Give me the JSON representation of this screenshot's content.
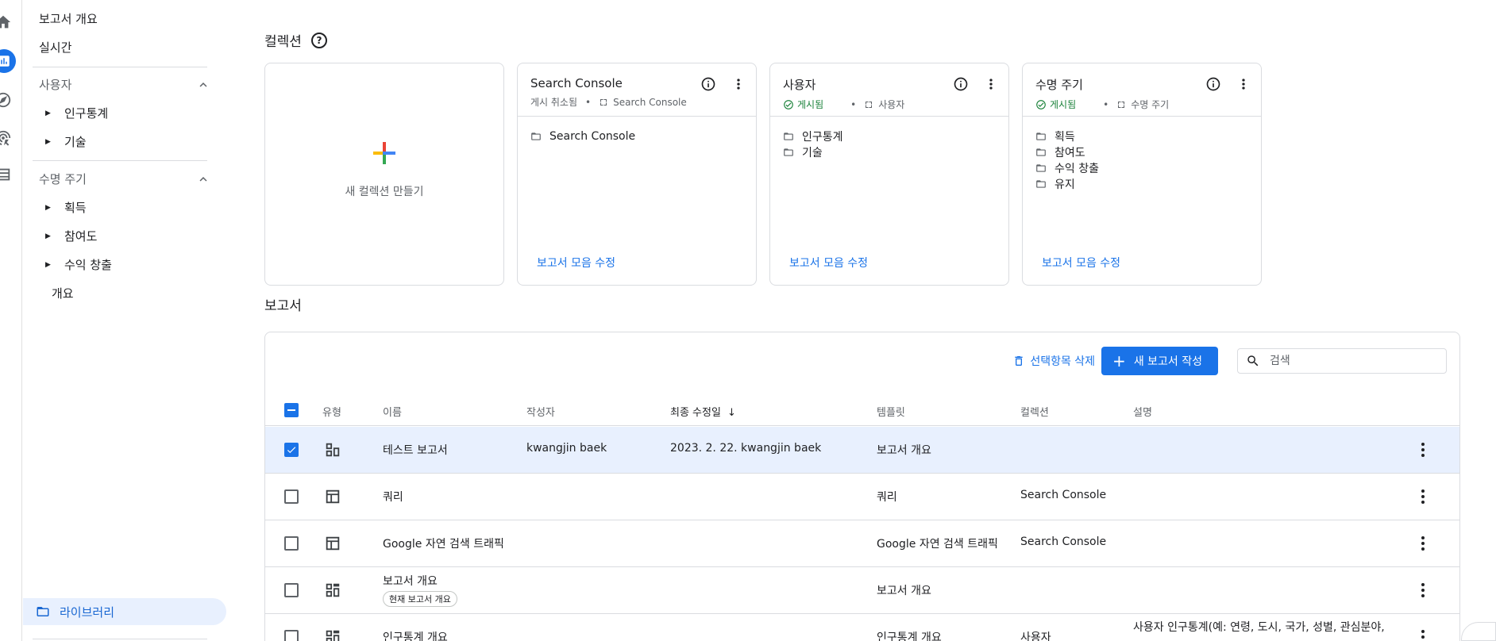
{
  "nav": {
    "overview": "보고서 개요",
    "realtime": "실시간",
    "section_user": "사용자",
    "demographics": "인구통계",
    "tech": "기술",
    "section_lifecycle": "수명 주기",
    "acquisition": "획득",
    "engagement": "참여도",
    "monetization": "수익 창출",
    "lifecycle_overview": "개요",
    "library": "라이브러리"
  },
  "collections": {
    "heading": "컬렉션",
    "new_label": "새 컬렉션 만들기",
    "edit_label": "보고서 모음 수정",
    "cards": [
      {
        "title": "Search Console",
        "status": "게시 취소됨",
        "template": "Search Console",
        "folders": [
          "Search Console"
        ]
      },
      {
        "title": "사용자",
        "status": "게시됨",
        "template": "사용자",
        "folders": [
          "인구통계",
          "기술"
        ]
      },
      {
        "title": "수명 주기",
        "status": "게시됨",
        "template": "수명 주기",
        "folders": [
          "획득",
          "참여도",
          "수익 창출",
          "유지"
        ]
      }
    ]
  },
  "reports": {
    "heading": "보고서",
    "delete_label": "선택항목 삭제",
    "new_label": "새 보고서 작성",
    "search_placeholder": "검색",
    "columns": {
      "type": "유형",
      "name": "이름",
      "author": "작성자",
      "modified": "최종 수정일",
      "template": "템플릿",
      "collection": "컬렉션",
      "description": "설명"
    },
    "rows": [
      {
        "name": "테스트 보고서",
        "author": "kwangjin baek",
        "modified": "2023. 2. 22. kwangjin baek",
        "template": "보고서 개요",
        "collection": "",
        "description": "",
        "chip": ""
      },
      {
        "name": "쿼리",
        "author": "",
        "modified": "",
        "template": "쿼리",
        "collection": "Search Console",
        "description": "",
        "chip": ""
      },
      {
        "name": "Google 자연 검색 트래픽",
        "author": "",
        "modified": "",
        "template": "Google 자연 검색 트래픽",
        "collection": "Search Console",
        "description": "",
        "chip": ""
      },
      {
        "name": "보고서 개요",
        "author": "",
        "modified": "",
        "template": "보고서 개요",
        "collection": "",
        "description": "",
        "chip": "현재 보고서 개요"
      },
      {
        "name": "인구통계 개요",
        "author": "",
        "modified": "",
        "template": "인구통계 개요",
        "collection": "사용자",
        "description": "사용자 인구통계(예: 연령, 도시, 국가, 성별, 관심분야,",
        "chip": ""
      }
    ]
  }
}
